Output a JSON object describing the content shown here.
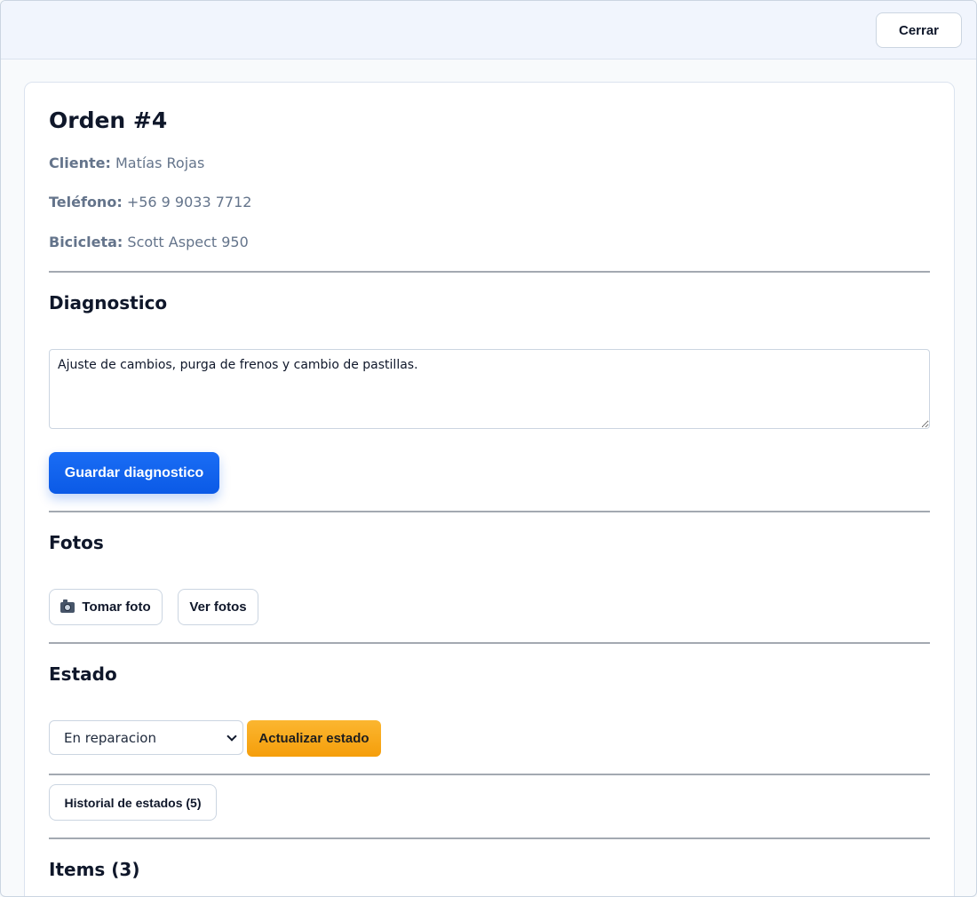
{
  "topbar": {
    "close_label": "Cerrar"
  },
  "order": {
    "title": "Orden #4",
    "client_label": "Cliente:",
    "client_value": "Matías Rojas",
    "phone_label": "Teléfono:",
    "phone_value": "+56 9 9033 7712",
    "bike_label": "Bicicleta:",
    "bike_value": "Scott Aspect 950"
  },
  "diagnosis": {
    "title": "Diagnostico",
    "text": "Ajuste de cambios, purga de frenos y cambio de pastillas.",
    "save_label": "Guardar diagnostico"
  },
  "photos": {
    "title": "Fotos",
    "take_label": "Tomar foto",
    "take_icon": "camera-icon",
    "view_label": "Ver fotos"
  },
  "status": {
    "title": "Estado",
    "selected": "En reparacion",
    "update_label": "Actualizar estado",
    "history_label": "Historial de estados (5)"
  },
  "items": {
    "title": "Items (3)"
  },
  "colors": {
    "primary": "#0b5ae6",
    "warning": "#f59e0b",
    "muted_text": "#64748b",
    "border": "#cbd5e1"
  }
}
